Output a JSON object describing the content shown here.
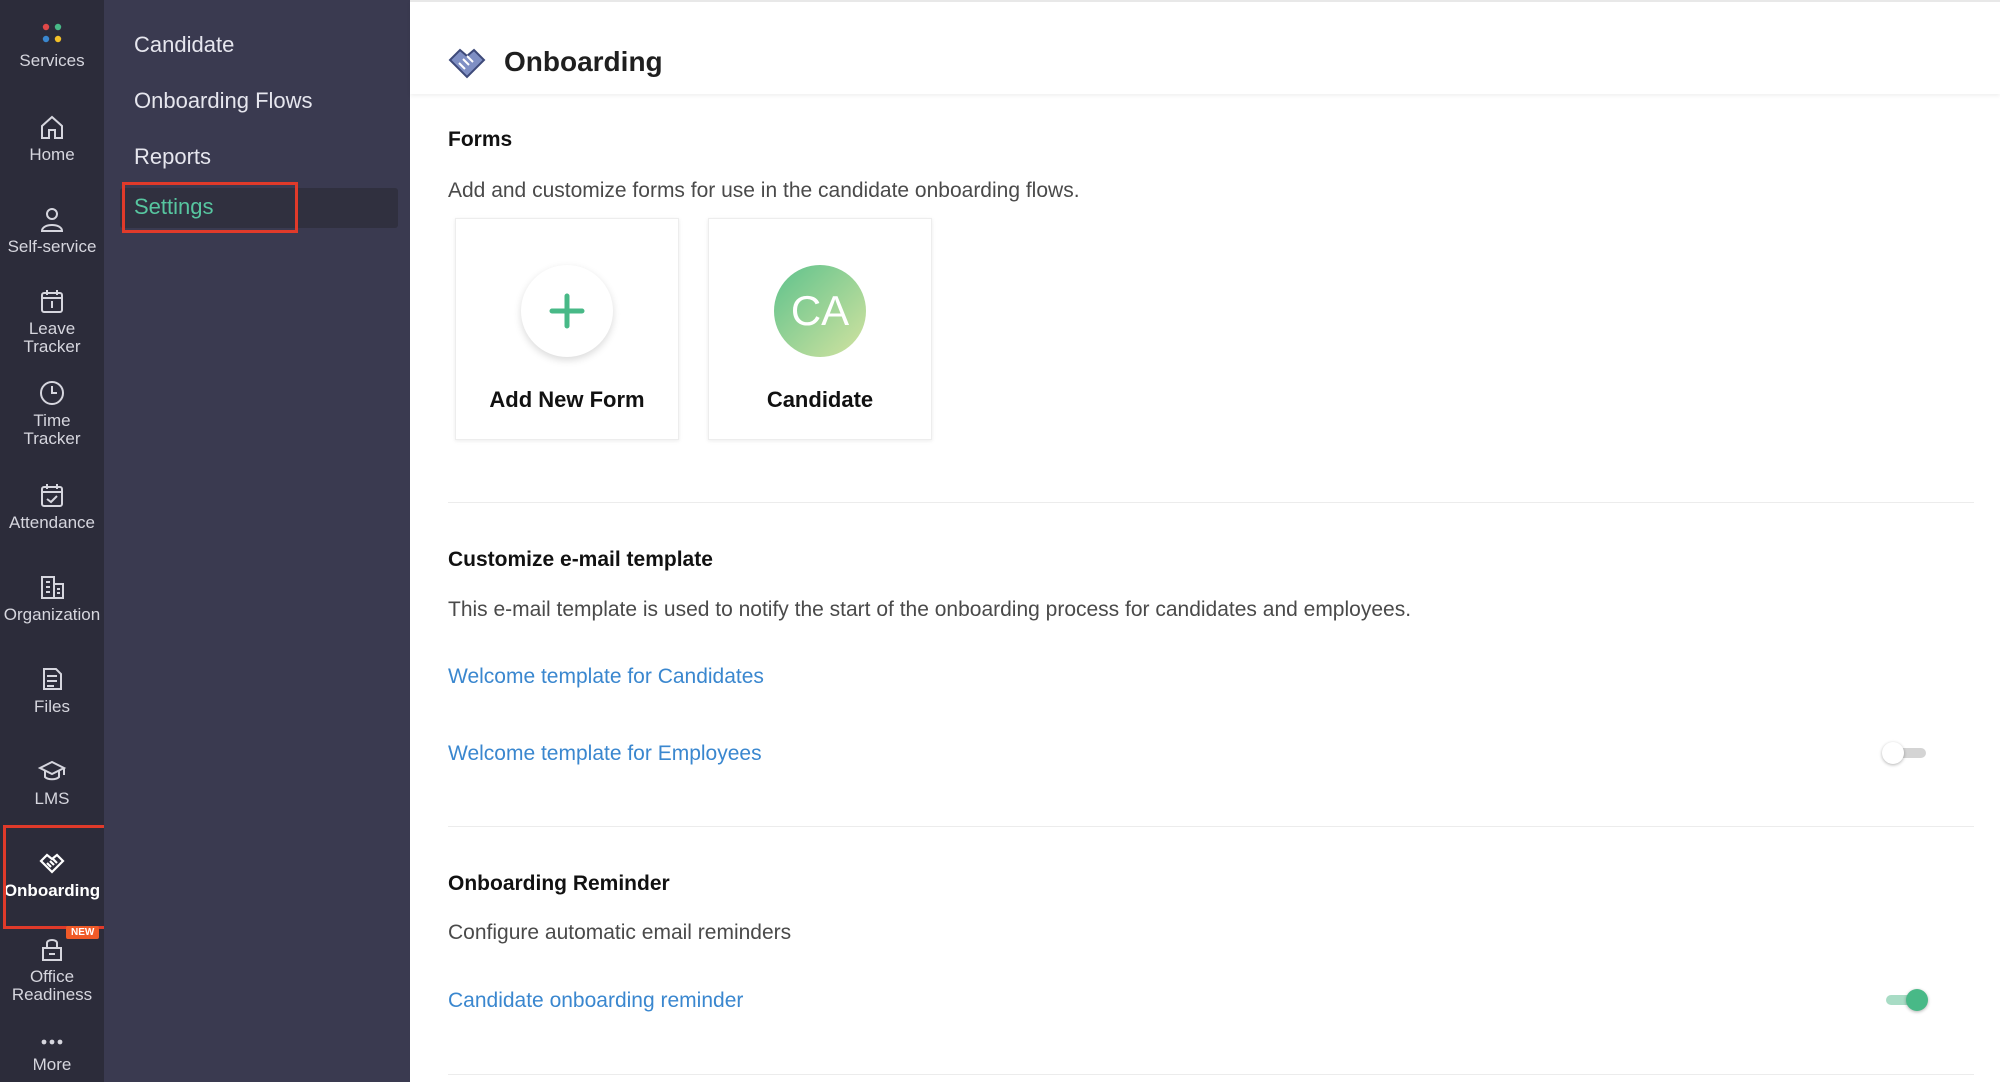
{
  "rail": {
    "items": [
      {
        "label": "Services",
        "icon": "services-dots-icon"
      },
      {
        "label": "Home",
        "icon": "home-icon"
      },
      {
        "label": "Self-service",
        "icon": "person-icon"
      },
      {
        "label": "Leave\nTracker",
        "icon": "calendar-icon"
      },
      {
        "label": "Time\nTracker",
        "icon": "clock-icon"
      },
      {
        "label": "Attendance",
        "icon": "calendar-check-icon"
      },
      {
        "label": "Organization",
        "icon": "building-icon"
      },
      {
        "label": "Files",
        "icon": "files-icon"
      },
      {
        "label": "LMS",
        "icon": "graduation-cap-icon"
      },
      {
        "label": "Onboarding",
        "icon": "handshake-icon"
      },
      {
        "label": "Office\nReadiness",
        "icon": "office-icon"
      },
      {
        "label": "More",
        "icon": "more-dots-icon"
      }
    ],
    "new_badge": "NEW"
  },
  "submenu": {
    "items": [
      "Candidate",
      "Onboarding Flows",
      "Reports",
      "Settings"
    ]
  },
  "header": {
    "title": "Onboarding"
  },
  "forms": {
    "title": "Forms",
    "description": "Add and customize forms for use in the candidate onboarding flows.",
    "add_label": "Add New Form",
    "candidate_initials": "CA",
    "candidate_label": "Candidate"
  },
  "email": {
    "title": "Customize e-mail template",
    "description": "This e-mail template is used to notify the start of the onboarding process for candidates and employees.",
    "candidates_link": "Welcome template for Candidates",
    "employees_link": "Welcome template for Employees",
    "employees_toggle": false
  },
  "reminder": {
    "title": "Onboarding Reminder",
    "description": "Configure automatic email reminders",
    "candidate_link": "Candidate onboarding reminder",
    "candidate_toggle": true
  },
  "colors": {
    "accent": "#48b987",
    "link": "#3a87cf",
    "highlight": "#e03a2a",
    "rail_bg": "#2c2c3a",
    "submenu_bg": "#3a3a50"
  }
}
